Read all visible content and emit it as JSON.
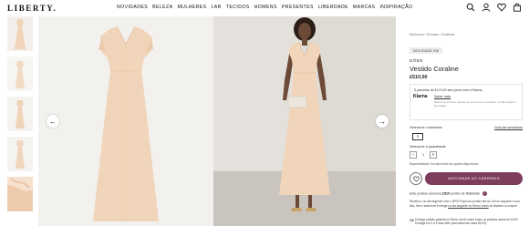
{
  "header": {
    "logo": "LIBERTY.",
    "nav": [
      "NOVIDADES",
      "BELEZA",
      "MULHERES",
      "LAR",
      "TECIDOS",
      "HOMENS",
      "PRESENTES",
      "LIBERDADE",
      "MARCAS",
      "INSPIRAÇÃO"
    ],
    "icons": [
      "search-icon",
      "account-icon",
      "wishlist-icon",
      "bag-icon"
    ]
  },
  "thumbnails": [
    "thumb-1",
    "thumb-2",
    "thumb-3",
    "thumb-4",
    "thumb-5"
  ],
  "gallery": {
    "prev_arrow": "←",
    "next_arrow": "→"
  },
  "product": {
    "breadcrumb": "Mulheres / Roupas / Vestidos",
    "badge": "NOVIDADE EM",
    "brand": "DÖEN",
    "name": "Vestido Coraline",
    "price": "£510,00",
    "klarna": {
      "line1": "3 parcelas de £170,00 sem juros com a Klarna.",
      "link": "Saber mais",
      "logo": "Klarna",
      "small": "Mesma de 18 anos. Aplicam-se os termos e condições. Crédito sujeito à aprovação."
    },
    "size_label": "Selecione o tamanho",
    "size_guide": "Guia de tamanhos",
    "size_option": "S",
    "qty_label": "Selecione a quantidade",
    "qty_minus": "−",
    "qty_value": "1",
    "qty_plus": "+",
    "availability": "Disponibilidade. Escolha entre as opções disponíveis.",
    "add_to_cart": "ADICIONAR AO CARRINHO",
    "points_prefix": "Este produto acumula",
    "points_value": "£510",
    "points_suffix": "pontos de fidelidade",
    "delivery_text": "Receba-o no dia seguinte com o DPD! Faça seu pedido até às 14h do seguinte a sua tela, foto e selecione Entrega",
    "delivery_link": "no dia seguinte no Reino Unido",
    "delivery_tail": "ao finalizar a compra*.",
    "express_text": "Entrega padrão gratuita no Reino Unido sobre todos os pedidos acima de £100! Entrega em 3 a 5 dias úteis (normalmente custa £5,00)."
  },
  "colors": {
    "accent": "#7d3d5d",
    "dress": "#f1d5bb",
    "background": "#ffffff"
  }
}
